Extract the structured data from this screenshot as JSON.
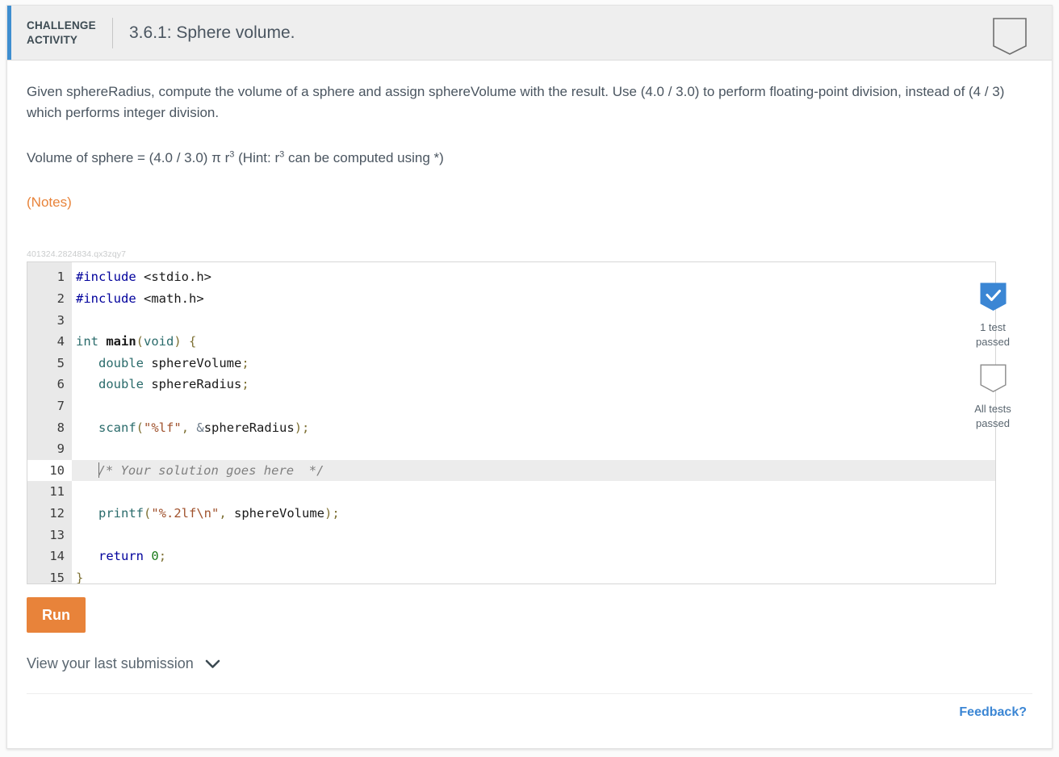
{
  "header": {
    "kicker_line1": "CHALLENGE",
    "kicker_line2": "ACTIVITY",
    "title": "3.6.1: Sphere volume.",
    "bookmark_icon": "pentagon-bookmark-outline-icon",
    "accent_color": "#3e8ed0",
    "background_color": "#eeeeee"
  },
  "prompt": {
    "paragraph1": "Given sphereRadius, compute the volume of a sphere and assign sphereVolume with the result. Use (4.0 / 3.0) to perform floating-point division, instead of (4 / 3) which performs integer division.",
    "formula_prefix": "Volume of sphere = (4.0 / 3.0) π r",
    "formula_exp1": "3",
    "formula_mid": " (Hint: r",
    "formula_exp2": "3",
    "formula_suffix": " can be computed using *)",
    "notes_label": "(Notes)",
    "notes_color": "#e8833a"
  },
  "editor": {
    "id_label": "401324.2824834.qx3zqy7",
    "active_line": 10,
    "language": "c",
    "lines": [
      {
        "n": "1",
        "tokens": [
          {
            "t": "#include",
            "c": "t-pre"
          },
          {
            "t": " ",
            "c": "t-id"
          },
          {
            "t": "<stdio.h>",
            "c": "t-inc"
          }
        ]
      },
      {
        "n": "2",
        "tokens": [
          {
            "t": "#include",
            "c": "t-pre"
          },
          {
            "t": " ",
            "c": "t-id"
          },
          {
            "t": "<math.h>",
            "c": "t-inc"
          }
        ]
      },
      {
        "n": "3",
        "tokens": []
      },
      {
        "n": "4",
        "tokens": [
          {
            "t": "int",
            "c": "t-type"
          },
          {
            "t": " ",
            "c": "t-id"
          },
          {
            "t": "main",
            "c": "t-fn"
          },
          {
            "t": "(",
            "c": "t-punc"
          },
          {
            "t": "void",
            "c": "t-type"
          },
          {
            "t": ")",
            "c": "t-punc"
          },
          {
            "t": " ",
            "c": "t-id"
          },
          {
            "t": "{",
            "c": "t-punc"
          }
        ]
      },
      {
        "n": "5",
        "tokens": [
          {
            "t": "   ",
            "c": "t-id"
          },
          {
            "t": "double",
            "c": "t-type"
          },
          {
            "t": " sphereVolume",
            "c": "t-id"
          },
          {
            "t": ";",
            "c": "t-punc"
          }
        ]
      },
      {
        "n": "6",
        "tokens": [
          {
            "t": "   ",
            "c": "t-id"
          },
          {
            "t": "double",
            "c": "t-type"
          },
          {
            "t": " sphereRadius",
            "c": "t-id"
          },
          {
            "t": ";",
            "c": "t-punc"
          }
        ]
      },
      {
        "n": "7",
        "tokens": []
      },
      {
        "n": "8",
        "tokens": [
          {
            "t": "   ",
            "c": "t-id"
          },
          {
            "t": "scanf",
            "c": "t-call"
          },
          {
            "t": "(",
            "c": "t-punc"
          },
          {
            "t": "\"%lf\"",
            "c": "t-str"
          },
          {
            "t": ",",
            "c": "t-punc"
          },
          {
            "t": " ",
            "c": "t-id"
          },
          {
            "t": "&",
            "c": "t-amp"
          },
          {
            "t": "sphereRadius",
            "c": "t-id"
          },
          {
            "t": ");",
            "c": "t-punc"
          }
        ]
      },
      {
        "n": "9",
        "tokens": []
      },
      {
        "n": "10",
        "tokens": [
          {
            "t": "   ",
            "c": "t-id"
          },
          {
            "t": "/* Your solution goes here  */",
            "c": "t-com"
          }
        ]
      },
      {
        "n": "11",
        "tokens": []
      },
      {
        "n": "12",
        "tokens": [
          {
            "t": "   ",
            "c": "t-id"
          },
          {
            "t": "printf",
            "c": "t-call"
          },
          {
            "t": "(",
            "c": "t-punc"
          },
          {
            "t": "\"%.2lf\\n\"",
            "c": "t-str"
          },
          {
            "t": ",",
            "c": "t-punc"
          },
          {
            "t": " sphereVolume",
            "c": "t-id"
          },
          {
            "t": ");",
            "c": "t-punc"
          }
        ]
      },
      {
        "n": "13",
        "tokens": []
      },
      {
        "n": "14",
        "tokens": [
          {
            "t": "   ",
            "c": "t-id"
          },
          {
            "t": "return",
            "c": "t-kw"
          },
          {
            "t": " ",
            "c": "t-id"
          },
          {
            "t": "0",
            "c": "t-num"
          },
          {
            "t": ";",
            "c": "t-punc"
          }
        ]
      },
      {
        "n": "15",
        "tokens": [
          {
            "t": "}",
            "c": "t-punc"
          }
        ]
      }
    ]
  },
  "tests": [
    {
      "icon": "pentagon-check-filled-icon",
      "state": "passed",
      "color": "#3b86d4",
      "label_line1": "1 test",
      "label_line2": "passed"
    },
    {
      "icon": "pentagon-outline-icon",
      "state": "empty",
      "color": "#8a8a8a",
      "label_line1": "All tests",
      "label_line2": "passed"
    }
  ],
  "actions": {
    "run_label": "Run",
    "run_color": "#e8833a",
    "last_submission_label": "View your last submission",
    "chevron_icon": "chevron-down-icon"
  },
  "footer": {
    "feedback_label": "Feedback?",
    "feedback_color": "#3b86d4"
  }
}
